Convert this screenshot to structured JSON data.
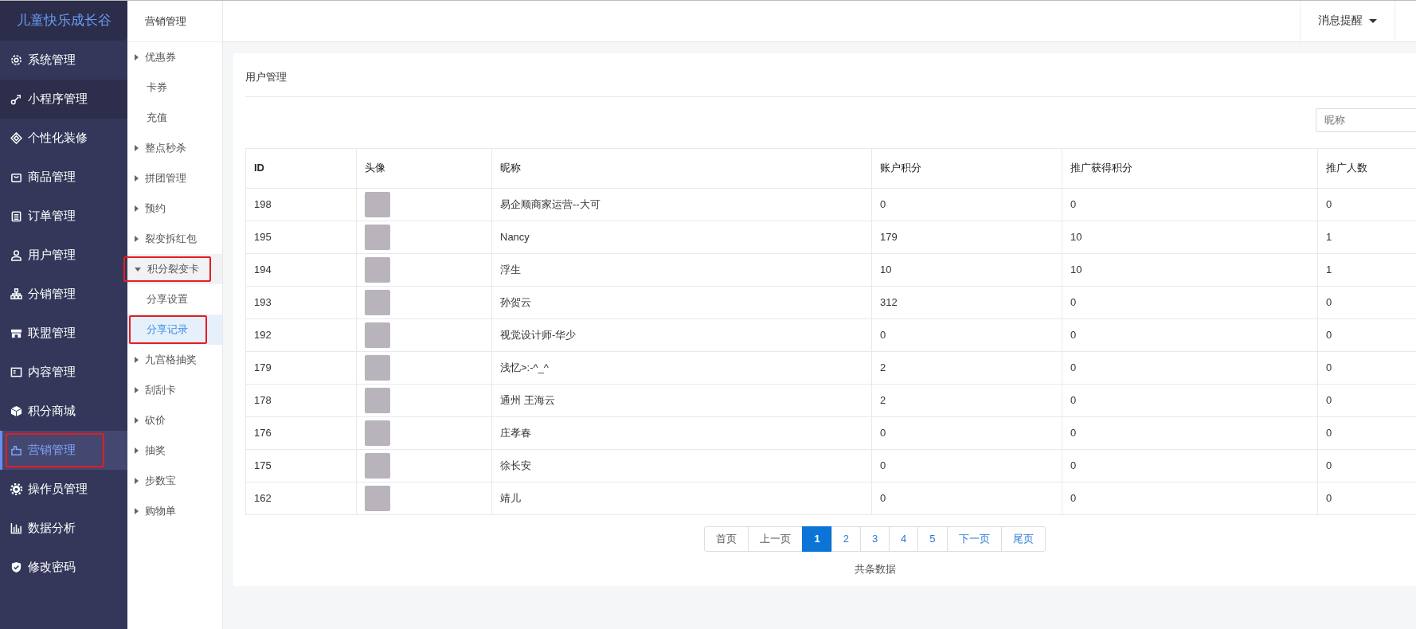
{
  "sidebar": {
    "logo": "儿童快乐成长谷",
    "items": [
      {
        "label": "系统管理",
        "selected": false,
        "hovered": false,
        "annotated": false
      },
      {
        "label": "小程序管理",
        "selected": false,
        "hovered": true,
        "annotated": false
      },
      {
        "label": "个性化装修",
        "selected": false,
        "hovered": false,
        "annotated": false
      },
      {
        "label": "商品管理",
        "selected": false,
        "hovered": false,
        "annotated": false
      },
      {
        "label": "订单管理",
        "selected": false,
        "hovered": false,
        "annotated": false
      },
      {
        "label": "用户管理",
        "selected": false,
        "hovered": false,
        "annotated": false
      },
      {
        "label": "分销管理",
        "selected": false,
        "hovered": false,
        "annotated": false
      },
      {
        "label": "联盟管理",
        "selected": false,
        "hovered": false,
        "annotated": false
      },
      {
        "label": "内容管理",
        "selected": false,
        "hovered": false,
        "annotated": false
      },
      {
        "label": "积分商城",
        "selected": false,
        "hovered": false,
        "annotated": false
      },
      {
        "label": "营销管理",
        "selected": true,
        "hovered": false,
        "annotated": true
      },
      {
        "label": "操作员管理",
        "selected": false,
        "hovered": false,
        "annotated": false
      },
      {
        "label": "数据分析",
        "selected": false,
        "hovered": false,
        "annotated": false
      },
      {
        "label": "修改密码",
        "selected": false,
        "hovered": false,
        "annotated": false
      }
    ]
  },
  "subnav": {
    "title": "营销管理",
    "items": [
      {
        "label": "优惠券",
        "kind": "group",
        "expanded": false,
        "selected": false,
        "annotated": false
      },
      {
        "label": "卡券",
        "kind": "leaf",
        "selected": false,
        "annotated": false
      },
      {
        "label": "充值",
        "kind": "leaf",
        "selected": false,
        "annotated": false
      },
      {
        "label": "整点秒杀",
        "kind": "group",
        "expanded": false,
        "selected": false,
        "annotated": false
      },
      {
        "label": "拼团管理",
        "kind": "group",
        "expanded": false,
        "selected": false,
        "annotated": false
      },
      {
        "label": "预约",
        "kind": "group",
        "expanded": false,
        "selected": false,
        "annotated": false
      },
      {
        "label": "裂变拆红包",
        "kind": "group",
        "expanded": false,
        "selected": false,
        "annotated": false
      },
      {
        "label": "积分裂变卡",
        "kind": "group",
        "expanded": true,
        "selected": false,
        "annotated": true,
        "children": [
          {
            "label": "分享设置",
            "kind": "leaf",
            "selected": false,
            "annotated": false
          },
          {
            "label": "分享记录",
            "kind": "leaf",
            "selected": true,
            "annotated": true
          }
        ]
      },
      {
        "label": "九宫格抽奖",
        "kind": "group",
        "expanded": false,
        "selected": false,
        "annotated": false
      },
      {
        "label": "刮刮卡",
        "kind": "group",
        "expanded": false,
        "selected": false,
        "annotated": false
      },
      {
        "label": "砍价",
        "kind": "group",
        "expanded": false,
        "selected": false,
        "annotated": false
      },
      {
        "label": "抽奖",
        "kind": "group",
        "expanded": false,
        "selected": false,
        "annotated": false
      },
      {
        "label": "步数宝",
        "kind": "group",
        "expanded": false,
        "selected": false,
        "annotated": false
      },
      {
        "label": "购物单",
        "kind": "group",
        "expanded": false,
        "selected": false,
        "annotated": false
      }
    ]
  },
  "topbar": {
    "notifications": "消息提醒"
  },
  "panel": {
    "title": "用户管理",
    "search": {
      "placeholder": "昵称"
    },
    "table": {
      "columns": [
        "ID",
        "头像",
        "昵称",
        "账户积分",
        "推广获得积分",
        "推广人数"
      ],
      "rows": [
        [
          "198",
          "",
          "易企顺商家运营--大可",
          "0",
          "0",
          "0"
        ],
        [
          "195",
          "",
          "Nancy",
          "179",
          "10",
          "1"
        ],
        [
          "194",
          "",
          "浮生",
          "10",
          "10",
          "1"
        ],
        [
          "193",
          "",
          "孙贺云",
          "312",
          "0",
          "0"
        ],
        [
          "192",
          "",
          "视觉设计师-华少",
          "0",
          "0",
          "0"
        ],
        [
          "179",
          "",
          "浅忆>:-^_^",
          "2",
          "0",
          "0"
        ],
        [
          "178",
          "",
          "通州 王海云",
          "2",
          "0",
          "0"
        ],
        [
          "176",
          "",
          "庄孝春",
          "0",
          "0",
          "0"
        ],
        [
          "175",
          "",
          "徐长安",
          "0",
          "0",
          "0"
        ],
        [
          "162",
          "",
          "靖儿",
          "0",
          "0",
          "0"
        ]
      ]
    },
    "pagination": [
      {
        "label": "首页",
        "selected": false,
        "disabled": true
      },
      {
        "label": "上一页",
        "selected": false,
        "disabled": true
      },
      {
        "label": "1",
        "selected": true,
        "disabled": false
      },
      {
        "label": "2",
        "selected": false,
        "disabled": false
      },
      {
        "label": "3",
        "selected": false,
        "disabled": false
      },
      {
        "label": "4",
        "selected": false,
        "disabled": false
      },
      {
        "label": "5",
        "selected": false,
        "disabled": false
      },
      {
        "label": "下一页",
        "selected": false,
        "disabled": false
      },
      {
        "label": "尾页",
        "selected": false,
        "disabled": false
      }
    ],
    "summary": "共条数据"
  }
}
